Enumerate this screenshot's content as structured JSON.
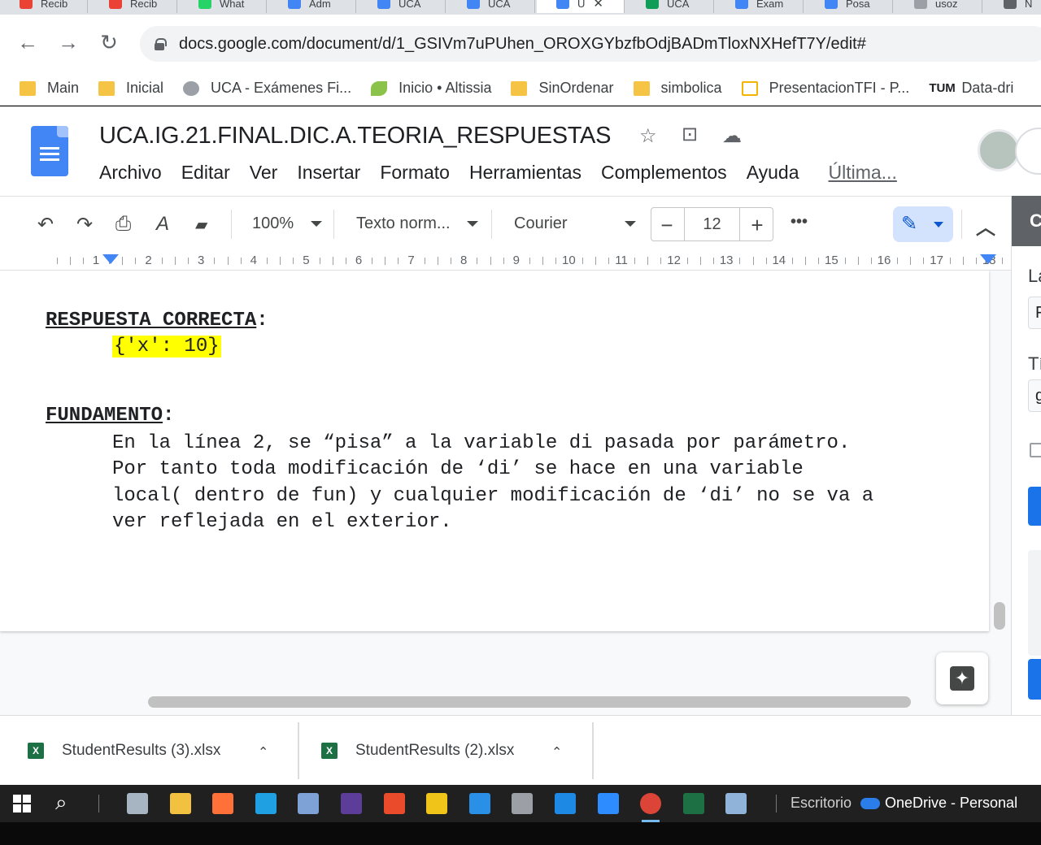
{
  "browser": {
    "tabs": [
      {
        "label": "Recib",
        "color": "#ea4335"
      },
      {
        "label": "Recib",
        "color": "#ea4335"
      },
      {
        "label": "What",
        "color": "#25d366"
      },
      {
        "label": "Adm",
        "color": "#4285f4"
      },
      {
        "label": "UCA",
        "color": "#4285f4"
      },
      {
        "label": "UCA",
        "color": "#4285f4"
      },
      {
        "label": "U",
        "color": "#4285f4",
        "active": true
      },
      {
        "label": "UCA",
        "color": "#0f9d58"
      },
      {
        "label": "Exam",
        "color": "#4285f4"
      },
      {
        "label": "Posa",
        "color": "#4285f4"
      },
      {
        "label": "usoz",
        "color": "#9aa0a6"
      },
      {
        "label": "N",
        "color": "#5f6368"
      }
    ],
    "url": "docs.google.com/document/d/1_GSIVm7uPUhen_OROXGYbzfbOdjBADmTloxNXHefT7Y/edit#",
    "nav": {
      "back": "←",
      "forward": "→",
      "reload": "↻"
    },
    "bookmarks": [
      {
        "label": "Main",
        "icon": "folder-icon"
      },
      {
        "label": "Inicial",
        "icon": "folder-icon"
      },
      {
        "label": "UCA - Exámenes Fi...",
        "icon": "globe-icon"
      },
      {
        "label": "Inicio • Altissia",
        "icon": "leaf-icon"
      },
      {
        "label": "SinOrdenar",
        "icon": "folder-icon"
      },
      {
        "label": "simbolica",
        "icon": "folder-icon"
      },
      {
        "label": "PresentacionTFI - P...",
        "icon": "slides-icon"
      },
      {
        "label": "Data-dri",
        "icon": "tum-logo",
        "icon_text": "TUM"
      }
    ]
  },
  "docs": {
    "title": "UCA.IG.21.FINAL.DIC.A.TEORIA_RESPUESTAS",
    "title_icons": {
      "star": "☆",
      "move": "⊡",
      "cloud": "☁"
    },
    "menu": [
      "Archivo",
      "Editar",
      "Ver",
      "Insertar",
      "Formato",
      "Herramientas",
      "Complementos",
      "Ayuda"
    ],
    "last_edit": "Última...",
    "toolbar": {
      "undo": "↶",
      "redo": "↷",
      "print": "⎙",
      "spellcheck": "A",
      "paint": "▰",
      "zoom": "100%",
      "style": "Texto norm...",
      "font": "Courier",
      "font_size": "12",
      "minus": "−",
      "plus": "+",
      "more": "•••",
      "edit_pen": "✎",
      "collapse": "︿"
    },
    "ruler_numbers": [
      "1",
      "2",
      "3",
      "4",
      "5",
      "6",
      "7",
      "8",
      "9",
      "10",
      "11",
      "12",
      "13",
      "14",
      "15",
      "16",
      "17",
      "18"
    ],
    "document": {
      "answer_heading": "RESPUESTA CORRECTA",
      "colon": ":",
      "answer_code": "{'x': 10}",
      "basis_heading": "FUNDAMENTO",
      "basis_lines": [
        "En la línea 2, se “pisa” a la variable di pasada por parámetro.",
        "Por tanto toda modificación de ‘di’ se hace en una variable",
        "local( dentro de fun) y cualquier modificación de ‘di’ no se va a",
        "ver reflejada en el exterior."
      ],
      "highlight_color": "#ffff00"
    },
    "side_panel": {
      "header": "C",
      "label1": "La",
      "box1": "F",
      "label2": "Tí",
      "box2": "g"
    },
    "explore_icon": "✦"
  },
  "downloads": [
    {
      "filename": "StudentResults (3).xlsx",
      "icon": "excel-icon"
    },
    {
      "filename": "StudentResults (2).xlsx",
      "icon": "excel-icon"
    }
  ],
  "taskbar": {
    "search_icon": "⌕",
    "apps": [
      {
        "name": "mail-app-icon",
        "color": "#a7b4c2"
      },
      {
        "name": "file-explorer-icon",
        "color": "#f3c140"
      },
      {
        "name": "firefox-icon",
        "color": "#ff7139"
      },
      {
        "name": "edge-icon",
        "color": "#1fa0e2"
      },
      {
        "name": "virtualbox-icon",
        "color": "#7ea2d6"
      },
      {
        "name": "eclipse-icon",
        "color": "#5c3d99"
      },
      {
        "name": "office-app-icon",
        "color": "#e94b2b"
      },
      {
        "name": "fiddler-icon",
        "color": "#f0c419"
      },
      {
        "name": "vscode-icon",
        "color": "#2a8fe6"
      },
      {
        "name": "typora-icon",
        "color": "#9aa0a6"
      },
      {
        "name": "phone-link-icon",
        "color": "#1e88e5"
      },
      {
        "name": "zoom-icon",
        "color": "#2d8cff"
      },
      {
        "name": "chrome-icon",
        "color": "#db4437",
        "active": true
      },
      {
        "name": "excel-icon",
        "color": "#1d7044"
      },
      {
        "name": "notepad-icon",
        "color": "#8fb3d9"
      }
    ],
    "desktop_label": "Escritorio",
    "onedrive_label": "OneDrive - Personal"
  }
}
